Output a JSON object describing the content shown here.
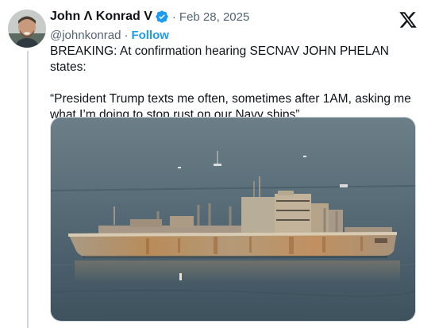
{
  "tweet": {
    "author_name": "John Λ Konrad V",
    "handle": "@johnkonrad",
    "follow_label": "Follow",
    "separator": "·",
    "date": "Feb 28, 2025",
    "paragraph_1": "BREAKING: At confirmation hearing SECNAV JOHN PHELAN states:",
    "paragraph_2": "“President Trump texts me often, sometimes after 1AM, asking me what I’m doing to stop rust on our Navy ships”",
    "verified": true
  },
  "icons": {
    "verified": "verified-badge-icon",
    "platform": "x-logo-icon"
  },
  "colors": {
    "accent": "#1d9bf0",
    "text_primary": "#0f1419",
    "text_secondary": "#536471",
    "water": "#4f6470",
    "hull_rust": "#b98c5a"
  }
}
